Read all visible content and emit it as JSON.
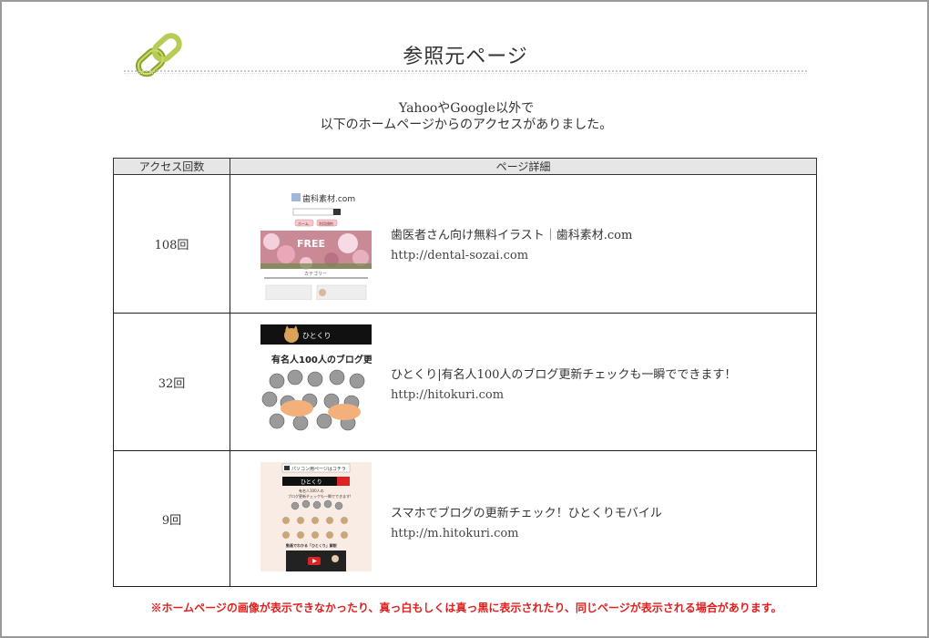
{
  "header": {
    "title": "参照元ページ"
  },
  "intro": {
    "line1": "YahooやGoogle以外で",
    "line2": "以下のホームページからのアクセスがありました。"
  },
  "table": {
    "col_count": "アクセス回数",
    "col_detail": "ページ詳細",
    "rows": [
      {
        "count": "108回",
        "site": "歯医者さん向け無料イラスト｜歯科素材.com",
        "url": "http://dental-sozai.com",
        "thumb": {
          "logo": "歯科素材.com",
          "btn1": "ホーム",
          "btn2": "利用規約",
          "banner": "FREE",
          "category": "カテゴリー"
        }
      },
      {
        "count": "32回",
        "site": "ひとくり|有名人100人のブログ更新チェックも一瞬でできます！",
        "url": "http://hitokuri.com",
        "thumb": {
          "brand": "ひとくり",
          "headline": "有名人100人のブログ更"
        }
      },
      {
        "count": "9回",
        "site": "スマホでブログの更新チェック！ひとくりモバイル",
        "url": "http://m.hitokuri.com",
        "thumb": {
          "topbar": "パソコン用ページはコチラ",
          "brand": "ひとくり",
          "lead": "有名人100人の",
          "lead2": "ブログ更新チェックも一瞬でできます!",
          "video_title": "動画でわかる「ひとくり」解説"
        }
      }
    ]
  },
  "note": "※ホームページの画像が表示できなかったり、真っ白もしくは真っ黒に表示されたり、同じページが表示される場合があります。",
  "colors": {
    "note_red": "#e02020",
    "chain_green": "#9bb53a",
    "header_gray": "#e6e6e6"
  }
}
